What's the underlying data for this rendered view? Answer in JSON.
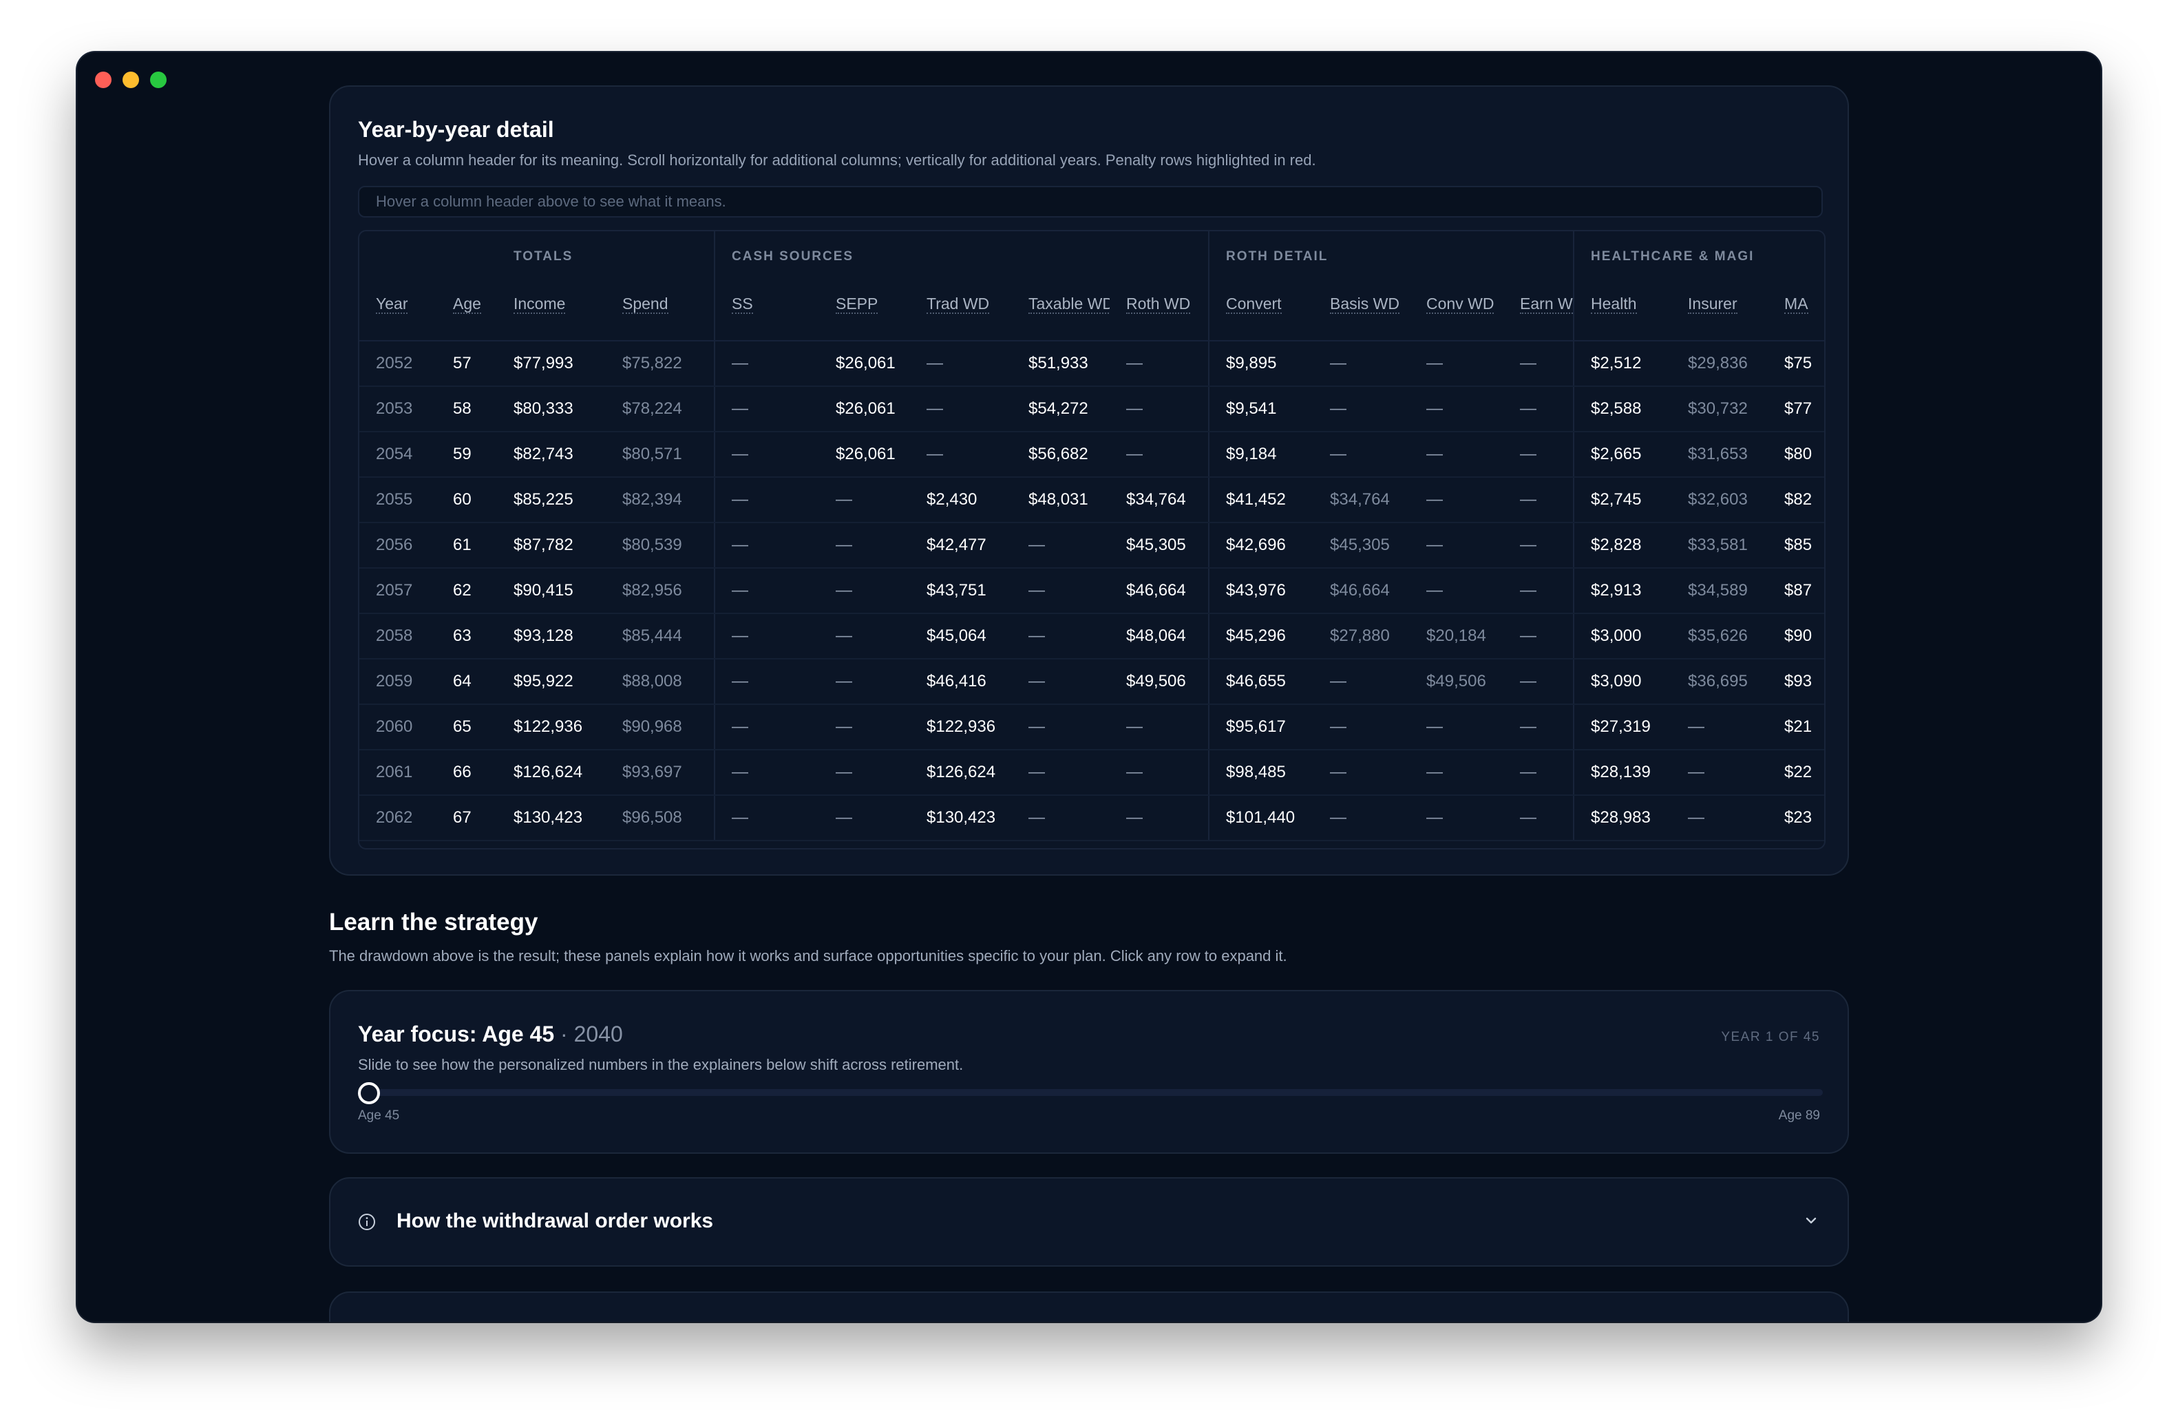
{
  "detail": {
    "title": "Year-by-year detail",
    "subtitle": "Hover a column header for its meaning. Scroll horizontally for additional columns; vertically for additional years. Penalty rows highlighted in red.",
    "hint": "Hover a column header above to see what it means.",
    "groups": {
      "totals": "TOTALS",
      "cash": "CASH SOURCES",
      "roth": "ROTH DETAIL",
      "health": "HEALTHCARE & MAGI"
    },
    "columns": [
      "Year",
      "Age",
      "Income",
      "Spend",
      "SS",
      "SEPP",
      "Trad WD",
      "Taxable WD",
      "Roth WD",
      "Convert",
      "Basis WD",
      "Conv WD",
      "Earn WD",
      "Health",
      "Insurer",
      "MA"
    ],
    "rows": [
      [
        "2052",
        "57",
        "$77,993",
        "$75,822",
        "—",
        "$26,061",
        "—",
        "$51,933",
        "—",
        "$9,895",
        "—",
        "—",
        "—",
        "$2,512",
        "$29,836",
        "$75"
      ],
      [
        "2053",
        "58",
        "$80,333",
        "$78,224",
        "—",
        "$26,061",
        "—",
        "$54,272",
        "—",
        "$9,541",
        "—",
        "—",
        "—",
        "$2,588",
        "$30,732",
        "$77"
      ],
      [
        "2054",
        "59",
        "$82,743",
        "$80,571",
        "—",
        "$26,061",
        "—",
        "$56,682",
        "—",
        "$9,184",
        "—",
        "—",
        "—",
        "$2,665",
        "$31,653",
        "$80"
      ],
      [
        "2055",
        "60",
        "$85,225",
        "$82,394",
        "—",
        "—",
        "$2,430",
        "$48,031",
        "$34,764",
        "$41,452",
        "$34,764",
        "—",
        "—",
        "$2,745",
        "$32,603",
        "$82"
      ],
      [
        "2056",
        "61",
        "$87,782",
        "$80,539",
        "—",
        "—",
        "$42,477",
        "—",
        "$45,305",
        "$42,696",
        "$45,305",
        "—",
        "—",
        "$2,828",
        "$33,581",
        "$85"
      ],
      [
        "2057",
        "62",
        "$90,415",
        "$82,956",
        "—",
        "—",
        "$43,751",
        "—",
        "$46,664",
        "$43,976",
        "$46,664",
        "—",
        "—",
        "$2,913",
        "$34,589",
        "$87"
      ],
      [
        "2058",
        "63",
        "$93,128",
        "$85,444",
        "—",
        "—",
        "$45,064",
        "—",
        "$48,064",
        "$45,296",
        "$27,880",
        "$20,184",
        "—",
        "$3,000",
        "$35,626",
        "$90"
      ],
      [
        "2059",
        "64",
        "$95,922",
        "$88,008",
        "—",
        "—",
        "$46,416",
        "—",
        "$49,506",
        "$46,655",
        "—",
        "$49,506",
        "—",
        "$3,090",
        "$36,695",
        "$93"
      ],
      [
        "2060",
        "65",
        "$122,936",
        "$90,968",
        "—",
        "—",
        "$122,936",
        "—",
        "—",
        "$95,617",
        "—",
        "—",
        "—",
        "$27,319",
        "—",
        "$21"
      ],
      [
        "2061",
        "66",
        "$126,624",
        "$93,697",
        "—",
        "—",
        "$126,624",
        "—",
        "—",
        "$98,485",
        "—",
        "—",
        "—",
        "$28,139",
        "—",
        "$22"
      ],
      [
        "2062",
        "67",
        "$130,423",
        "$96,508",
        "—",
        "—",
        "$130,423",
        "—",
        "—",
        "$101,440",
        "—",
        "—",
        "—",
        "$28,983",
        "—",
        "$23"
      ]
    ]
  },
  "learn": {
    "title": "Learn the strategy",
    "subtitle": "The drawdown above is the result; these panels explain how it works and surface opportunities specific to your plan. Click any row to expand it."
  },
  "focus": {
    "title_prefix": "Year focus: Age 45",
    "year": " · 2040",
    "count": "YEAR 1 OF 45",
    "subtitle": "Slide to see how the personalized numbers in the explainers below shift across retirement.",
    "min_label": "Age 45",
    "max_label": "Age 89",
    "slider_value": 0
  },
  "accordion": {
    "title": "How the withdrawal order works",
    "icon": "info-icon",
    "chevron": "chevron-down-icon"
  }
}
